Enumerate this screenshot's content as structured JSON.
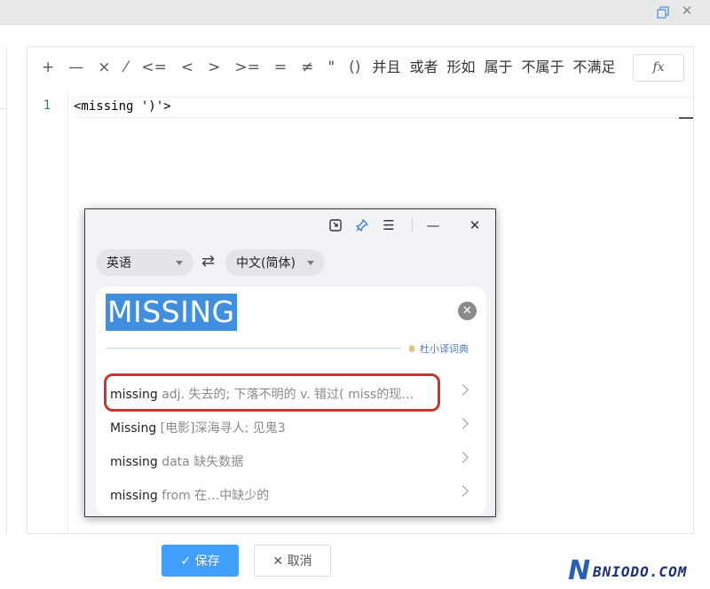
{
  "window": {
    "restore_icon": "restore-window-icon",
    "close_icon": "close-icon",
    "close_glyph": "✕"
  },
  "toolbar": {
    "operators": [
      "+",
      "—",
      "×",
      "⁄",
      "<=",
      "<",
      ">",
      ">=",
      "=",
      "≠",
      "\"",
      "()"
    ],
    "keywords": [
      "并且",
      "或者",
      "形如",
      "属于",
      "不属于",
      "不满足"
    ],
    "fx_label": "fx"
  },
  "editor": {
    "line_number": "1",
    "code": "<missing ')'>"
  },
  "footer": {
    "save_label": "✓ 保存",
    "cancel_label": "✕ 取消"
  },
  "watermark": {
    "brand_letter": "N",
    "text": "BNIODO.COM"
  },
  "popup": {
    "header_icons": [
      "screenshot-icon",
      "pin-icon",
      "menu-icon",
      "minimize-icon",
      "close-icon"
    ],
    "header_glyphs": {
      "menu": "☰",
      "minimize": "—",
      "close": "✕"
    },
    "source_lang": "英语",
    "swap_glyph": "⇄",
    "target_lang": "中文(简体)",
    "query": "MISSING",
    "clear_glyph": "✕",
    "dict_source": "杜小译词典",
    "suggestions": [
      {
        "term": "missing",
        "rest": " adj. 失去的; 下落不明的 v. 错过( miss的现…"
      },
      {
        "term": "Missing",
        "rest": " [电影]深海寻人; 见鬼3"
      },
      {
        "term": "missing",
        "rest": " data 缺失数据"
      },
      {
        "term": "missing",
        "rest": " from 在…中缺少的"
      }
    ]
  },
  "colors": {
    "accent": "#409eff",
    "query_highlight": "#3f8ee0",
    "annotation_ring": "#c0392b",
    "line_number": "#237893"
  }
}
